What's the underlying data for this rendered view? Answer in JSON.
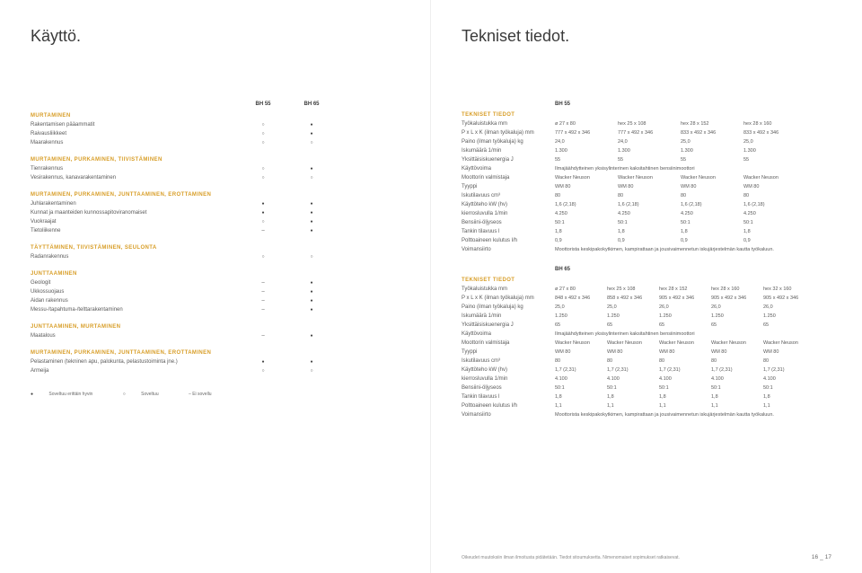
{
  "left": {
    "title": "Käyttö.",
    "cols": [
      "BH 55",
      "BH 65"
    ],
    "sections": [
      {
        "head": "MURTAMINEN",
        "rows": [
          {
            "label": "Rakentamisen pääammatit",
            "vals": [
              "ring",
              "filled"
            ]
          },
          {
            "label": "Raivausliikkeet",
            "vals": [
              "ring",
              "filled"
            ]
          },
          {
            "label": "Maarakennus",
            "vals": [
              "ring",
              "ring"
            ]
          }
        ]
      },
      {
        "head": "MURTAMINEN, PURKAMINEN, TIIVISTÄMINEN",
        "rows": [
          {
            "label": "Tienrakennus",
            "vals": [
              "ring",
              "filled"
            ]
          },
          {
            "label": "Vesirakennus, kanavarakentaminen",
            "vals": [
              "ring",
              "ring"
            ]
          }
        ]
      },
      {
        "head": "MURTAMINEN, PURKAMINEN, JUNTTAAMINEN, EROTTAMINEN",
        "rows": [
          {
            "label": "Juhlarakentaminen",
            "vals": [
              "filled",
              "filled"
            ]
          },
          {
            "label": "Kunnat ja maanteiden kunnossapitoviranomaiset",
            "vals": [
              "filled",
              "filled"
            ]
          },
          {
            "label": "Vuokraajat",
            "vals": [
              "ring",
              "filled"
            ]
          },
          {
            "label": "Tietoliikenne",
            "vals": [
              "dash",
              "filled"
            ]
          }
        ]
      },
      {
        "head": "TÄYTTÄMINEN, TIIVISTÄMINEN, SEULONTA",
        "rows": [
          {
            "label": "Radanrakennus",
            "vals": [
              "ring",
              "ring"
            ]
          }
        ]
      },
      {
        "head": "JUNTTAAMINEN",
        "rows": [
          {
            "label": "Geologit",
            "vals": [
              "dash",
              "filled"
            ]
          },
          {
            "label": "Ukkossuojaus",
            "vals": [
              "dash",
              "filled"
            ]
          },
          {
            "label": "Aidan rakennus",
            "vals": [
              "dash",
              "filled"
            ]
          },
          {
            "label": "Messu-/tapahtuma-/telttarakentaminen",
            "vals": [
              "dash",
              "filled"
            ]
          }
        ]
      },
      {
        "head": "JUNTTAAMINEN, MURTAMINEN",
        "rows": [
          {
            "label": "Maatalous",
            "vals": [
              "dash",
              "filled"
            ]
          }
        ]
      },
      {
        "head": "MURTAMINEN, PURKAMINEN, JUNTTAAMINEN, EROTTAMINEN",
        "rows": [
          {
            "label": "Pelastaminen (tekninen apu, palokunta, pelastustoiminta jne.)",
            "vals": [
              "filled",
              "filled"
            ]
          },
          {
            "label": "Armeija",
            "vals": [
              "ring",
              "ring"
            ]
          }
        ]
      }
    ],
    "legend": {
      "good": "Soveltuu erittäin hyvin",
      "ok": "Soveltuu",
      "no": "Ei sovellu"
    }
  },
  "right": {
    "title": "Tekniset tiedot.",
    "spec55": {
      "model": "BH 55",
      "head": "TEKNISET TIEDOT",
      "cols": [
        "ø 27 x 80",
        "hex 25 x 108",
        "hex 28 x 152",
        "hex 28 x 160"
      ],
      "rows": [
        {
          "label": "Työkaluistukka mm",
          "vals": [
            "ø 27 x 80",
            "hex 25 x 108",
            "hex 28 x 152",
            "hex 28 x 160"
          ]
        },
        {
          "label": "P x L x K (ilman työkaluja) mm",
          "vals": [
            "777 x 492 x 346",
            "777 x 492 x 346",
            "833 x 492 x 346",
            "833 x 492 x 346"
          ]
        },
        {
          "label": "Paino (ilman työkaluja) kg",
          "vals": [
            "24,0",
            "24,0",
            "25,0",
            "25,0"
          ]
        },
        {
          "label": "Iskumäärä 1/min",
          "vals": [
            "1.300",
            "1.300",
            "1.300",
            "1.300"
          ]
        },
        {
          "label": "Yksittäisiskuenergia J",
          "vals": [
            "55",
            "55",
            "55",
            "55"
          ]
        },
        {
          "label": "Käyttövoima",
          "span": "Ilmajäähdytteinen yksisylinterinen kaksitahtinen bensiinimoottori"
        },
        {
          "label": "Moottorin valmistaja",
          "vals": [
            "Wacker Neuson",
            "Wacker Neuson",
            "Wacker Neuson",
            "Wacker Neuson"
          ]
        },
        {
          "label": "Tyyppi",
          "vals": [
            "WM 80",
            "WM 80",
            "WM 80",
            "WM 80"
          ]
        },
        {
          "label": "Iskutilavuus cm³",
          "vals": [
            "80",
            "80",
            "80",
            "80"
          ]
        },
        {
          "label": "Käyttöteho kW (hv)",
          "vals": [
            "1,6 (2,18)",
            "1,6 (2,18)",
            "1,6 (2,18)",
            "1,6 (2,18)"
          ]
        },
        {
          "label": "kierrosluvulla 1/min",
          "vals": [
            "4.250",
            "4.250",
            "4.250",
            "4.250"
          ]
        },
        {
          "label": "Bensiini-öljyseos",
          "vals": [
            "50:1",
            "50:1",
            "50:1",
            "50:1"
          ]
        },
        {
          "label": "Tankin tilavuus l",
          "vals": [
            "1,8",
            "1,8",
            "1,8",
            "1,8"
          ]
        },
        {
          "label": "Polttoaineen kulutus l/h",
          "vals": [
            "0,9",
            "0,9",
            "0,9",
            "0,9"
          ]
        },
        {
          "label": "Voimansiirto",
          "span": "Moottorista keskipakokytkimen, kampirattaan ja jousivaimennetun iskujärjestelmän kautta työkaluun."
        }
      ]
    },
    "spec65": {
      "model": "BH 65",
      "head": "TEKNISET TIEDOT",
      "cols": [
        "ø 27 x 80",
        "hex 25 x 108",
        "hex 28 x 152",
        "hex 28 x 160",
        "hex 32 x 160"
      ],
      "rows": [
        {
          "label": "Työkaluistukka mm",
          "vals": [
            "ø 27 x 80",
            "hex 25 x 108",
            "hex 28 x 152",
            "hex 28 x 160",
            "hex 32 x 160"
          ]
        },
        {
          "label": "P x L x K (ilman työkaluja) mm",
          "vals": [
            "848 x 492 x 346",
            "858 x 492 x 346",
            "905 x 492 x 346",
            "905 x 492 x 346",
            "905 x 492 x 346"
          ]
        },
        {
          "label": "Paino (ilman työkaluja) kg",
          "vals": [
            "25,0",
            "25,0",
            "26,0",
            "26,0",
            "26,0"
          ]
        },
        {
          "label": "Iskumäärä 1/min",
          "vals": [
            "1.250",
            "1.250",
            "1.250",
            "1.250",
            "1.250"
          ]
        },
        {
          "label": "Yksittäisiskuenergia J",
          "vals": [
            "65",
            "65",
            "65",
            "65",
            "65"
          ]
        },
        {
          "label": "Käyttövoima",
          "span": "Ilmajäähdytteinen yksisylinterinen kaksitahtinen bensiinimoottori"
        },
        {
          "label": "Moottorin valmistaja",
          "vals": [
            "Wacker Neuson",
            "Wacker Neuson",
            "Wacker Neuson",
            "Wacker Neuson",
            "Wacker Neuson"
          ]
        },
        {
          "label": "Tyyppi",
          "vals": [
            "WM 80",
            "WM 80",
            "WM 80",
            "WM 80",
            "WM 80"
          ]
        },
        {
          "label": "Iskutilavuus cm³",
          "vals": [
            "80",
            "80",
            "80",
            "80",
            "80"
          ]
        },
        {
          "label": "Käyttöteho kW (hv)",
          "vals": [
            "1,7 (2,31)",
            "1,7 (2,31)",
            "1,7 (2,31)",
            "1,7 (2,31)",
            "1,7 (2,31)"
          ]
        },
        {
          "label": "kierrosluvulla 1/min",
          "vals": [
            "4.100",
            "4.100",
            "4.100",
            "4.100",
            "4.100"
          ]
        },
        {
          "label": "Bensiini-öljyseos",
          "vals": [
            "50:1",
            "50:1",
            "50:1",
            "50:1",
            "50:1"
          ]
        },
        {
          "label": "Tankin tilavuus l",
          "vals": [
            "1,8",
            "1,8",
            "1,8",
            "1,8",
            "1,8"
          ]
        },
        {
          "label": "Polttoaineen kulutus l/h",
          "vals": [
            "1,1",
            "1,1",
            "1,1",
            "1,1",
            "1,1"
          ]
        },
        {
          "label": "Voimansiirto",
          "span": "Moottorista keskipakokytkimen, kampirattaan ja jousivaimennetun iskujärjestelmän kautta työkaluun."
        }
      ]
    },
    "footnote": "Oikeudet muutoksiin ilman ilmoitusta pidätetään. Tiedot sitoumuksetta. Nimenomaiset sopimukset ratkaisevat.",
    "page_a": "16",
    "page_sep": "_",
    "page_b": "17"
  }
}
